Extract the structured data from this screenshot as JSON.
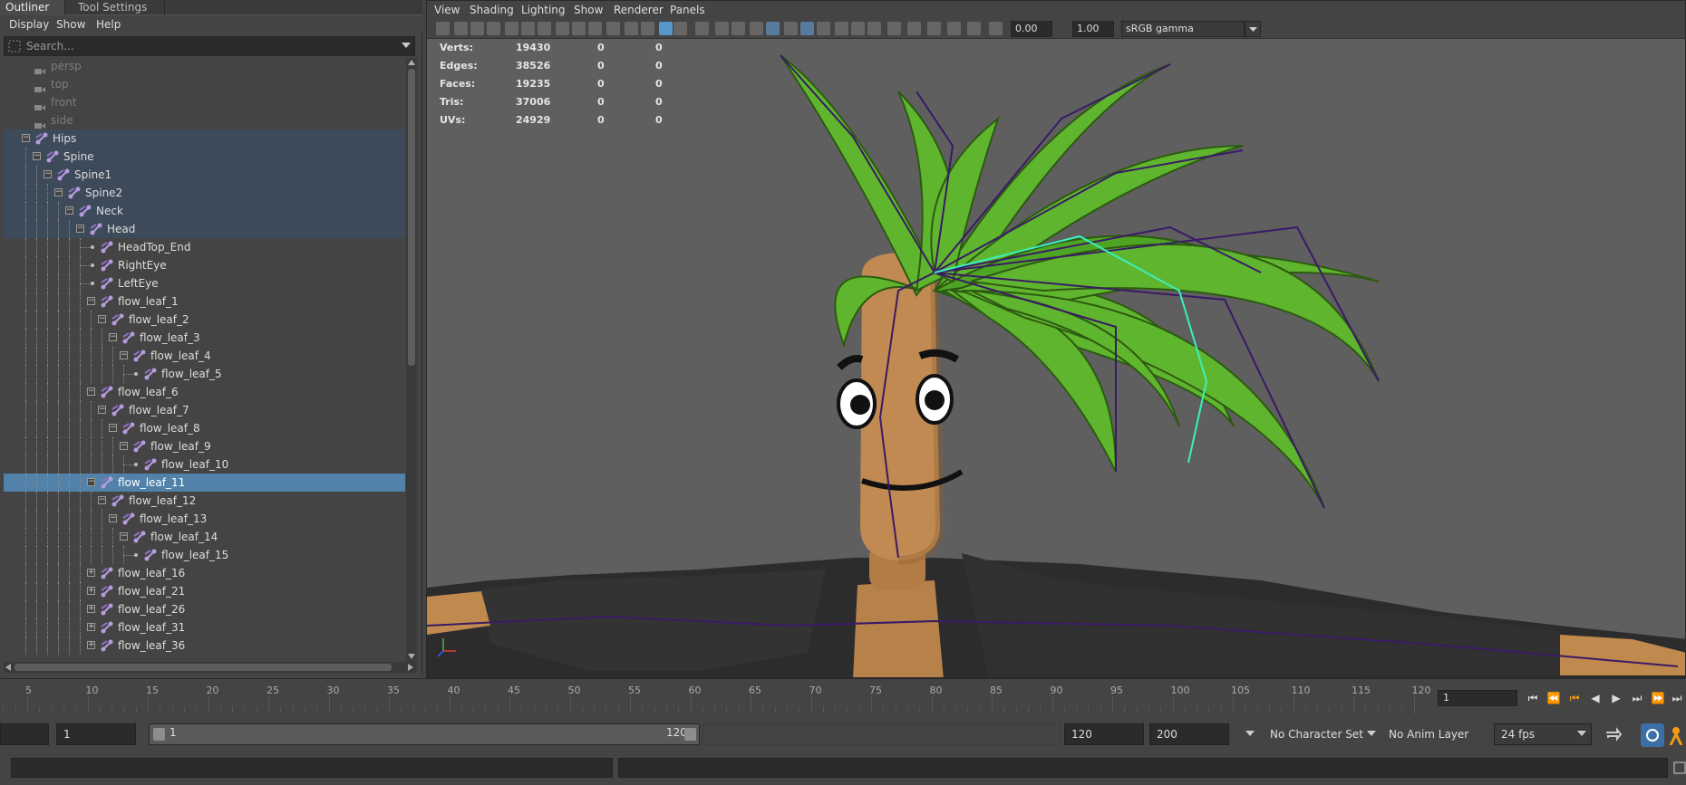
{
  "outliner": {
    "tabs": [
      "Outliner",
      "Tool Settings"
    ],
    "menu": [
      "Display",
      "Show",
      "Help"
    ],
    "search_placeholder": "Search...",
    "rows": [
      {
        "label": "persp",
        "kind": "camera",
        "level": 0
      },
      {
        "label": "top",
        "kind": "camera",
        "level": 0
      },
      {
        "label": "front",
        "kind": "camera",
        "level": 0
      },
      {
        "label": "side",
        "kind": "camera",
        "level": 0
      },
      {
        "label": "Hips",
        "kind": "joint",
        "level": 0,
        "expand": "-",
        "hl": true
      },
      {
        "label": "Spine",
        "kind": "joint",
        "level": 1,
        "expand": "-",
        "hl": true
      },
      {
        "label": "Spine1",
        "kind": "joint",
        "level": 2,
        "expand": "-",
        "hl": true
      },
      {
        "label": "Spine2",
        "kind": "joint",
        "level": 3,
        "expand": "-",
        "hl": true
      },
      {
        "label": "Neck",
        "kind": "joint",
        "level": 4,
        "expand": "-",
        "hl": true
      },
      {
        "label": "Head",
        "kind": "joint",
        "level": 5,
        "expand": "-",
        "hl": true
      },
      {
        "label": "HeadTop_End",
        "kind": "joint",
        "level": 6,
        "expand": "."
      },
      {
        "label": "RightEye",
        "kind": "joint",
        "level": 6,
        "expand": "."
      },
      {
        "label": "LeftEye",
        "kind": "joint",
        "level": 6,
        "expand": "."
      },
      {
        "label": "flow_leaf_1",
        "kind": "joint",
        "level": 6,
        "expand": "-"
      },
      {
        "label": "flow_leaf_2",
        "kind": "joint",
        "level": 7,
        "expand": "-"
      },
      {
        "label": "flow_leaf_3",
        "kind": "joint",
        "level": 8,
        "expand": "-"
      },
      {
        "label": "flow_leaf_4",
        "kind": "joint",
        "level": 9,
        "expand": "-"
      },
      {
        "label": "flow_leaf_5",
        "kind": "joint",
        "level": 10,
        "expand": "."
      },
      {
        "label": "flow_leaf_6",
        "kind": "joint",
        "level": 6,
        "expand": "-"
      },
      {
        "label": "flow_leaf_7",
        "kind": "joint",
        "level": 7,
        "expand": "-"
      },
      {
        "label": "flow_leaf_8",
        "kind": "joint",
        "level": 8,
        "expand": "-"
      },
      {
        "label": "flow_leaf_9",
        "kind": "joint",
        "level": 9,
        "expand": "-"
      },
      {
        "label": "flow_leaf_10",
        "kind": "joint",
        "level": 10,
        "expand": "."
      },
      {
        "label": "flow_leaf_11",
        "kind": "joint",
        "level": 6,
        "expand": "-",
        "sel": true
      },
      {
        "label": "flow_leaf_12",
        "kind": "joint",
        "level": 7,
        "expand": "-"
      },
      {
        "label": "flow_leaf_13",
        "kind": "joint",
        "level": 8,
        "expand": "-"
      },
      {
        "label": "flow_leaf_14",
        "kind": "joint",
        "level": 9,
        "expand": "-"
      },
      {
        "label": "flow_leaf_15",
        "kind": "joint",
        "level": 10,
        "expand": "."
      },
      {
        "label": "flow_leaf_16",
        "kind": "joint",
        "level": 6,
        "expand": "+"
      },
      {
        "label": "flow_leaf_21",
        "kind": "joint",
        "level": 6,
        "expand": "+"
      },
      {
        "label": "flow_leaf_26",
        "kind": "joint",
        "level": 6,
        "expand": "+"
      },
      {
        "label": "flow_leaf_31",
        "kind": "joint",
        "level": 6,
        "expand": "+"
      },
      {
        "label": "flow_leaf_36",
        "kind": "joint",
        "level": 6,
        "expand": "+"
      }
    ]
  },
  "viewport": {
    "menu": [
      "View",
      "Shading",
      "Lighting",
      "Show",
      "Renderer",
      "Panels"
    ],
    "exposure": "0.00",
    "gamma": "1.00",
    "color_space": "sRGB gamma",
    "stats": [
      {
        "label": "Verts:",
        "v1": "19430",
        "v2": "0",
        "v3": "0"
      },
      {
        "label": "Edges:",
        "v1": "38526",
        "v2": "0",
        "v3": "0"
      },
      {
        "label": "Faces:",
        "v1": "19235",
        "v2": "0",
        "v3": "0"
      },
      {
        "label": "Tris:",
        "v1": "37006",
        "v2": "0",
        "v3": "0"
      },
      {
        "label": "UVs:",
        "v1": "24929",
        "v2": "0",
        "v3": "0"
      }
    ]
  },
  "timeline": {
    "ticks": [
      "5",
      "10",
      "15",
      "20",
      "25",
      "30",
      "35",
      "40",
      "45",
      "50",
      "55",
      "60",
      "65",
      "70",
      "75",
      "80",
      "85",
      "90",
      "95",
      "100",
      "105",
      "110",
      "115",
      "120"
    ],
    "current_frame": "1"
  },
  "range": {
    "start": "1",
    "slider_start": "1",
    "slider_end": "120",
    "end": "120",
    "anim_end": "200",
    "character_set": "No Character Set",
    "anim_layer": "No Anim Layer",
    "fps": "24 fps"
  },
  "colors": {
    "selection": "#5282a9",
    "highlight": "#3d4a5a",
    "leaf_green": "#5fb52d",
    "joint_purple": "#3a1a66"
  }
}
